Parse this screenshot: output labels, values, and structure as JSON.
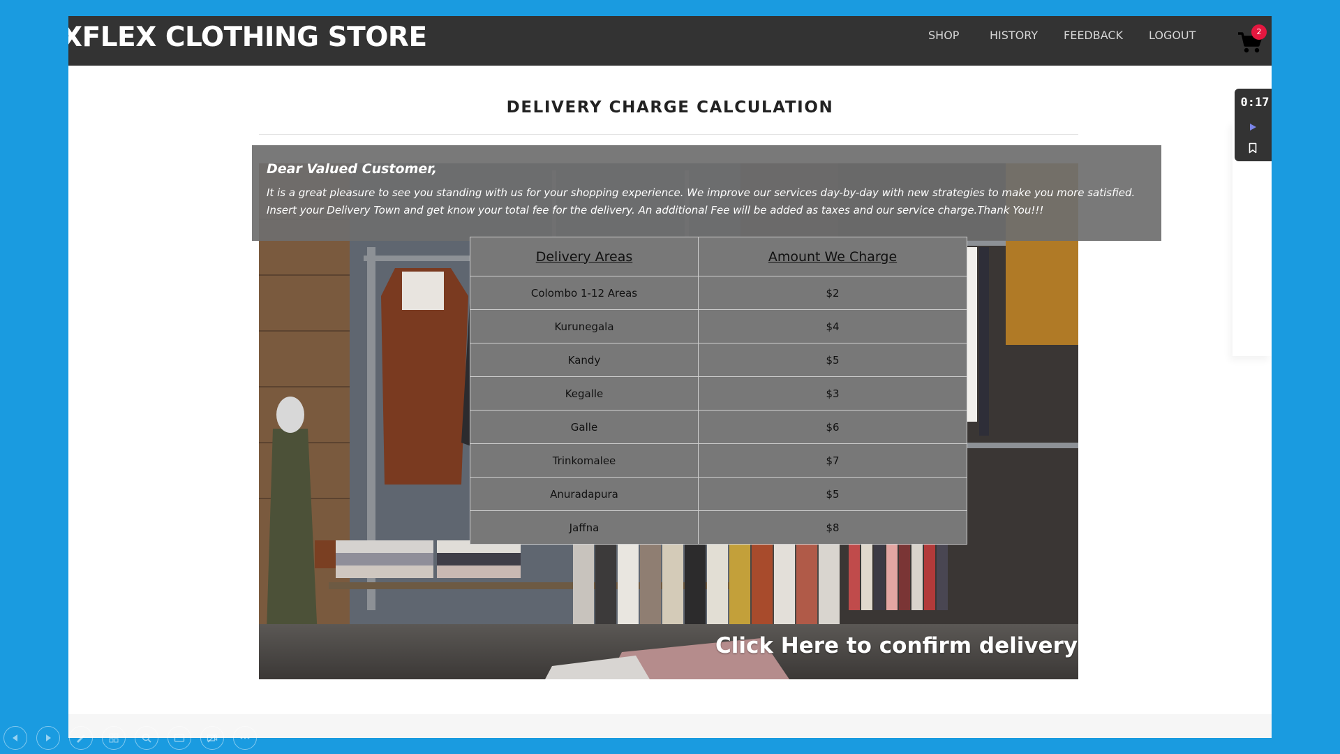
{
  "header": {
    "brand": "XFLEX CLOTHING STORE",
    "nav": [
      "SHOP",
      "HISTORY",
      "FEEDBACK",
      "LOGOUT"
    ],
    "cart_count": "2"
  },
  "timer": {
    "time": "0:17"
  },
  "page": {
    "title": "DELIVERY CHARGE CALCULATION"
  },
  "notice": {
    "greeting": "Dear Valued Customer,",
    "body": "It is a great pleasure to see you standing with us for your shopping experience. We improve our services day-by-day with new strategies to make you more satisfied. Insert your Delivery Town and get know your total fee for the delivery. An additional Fee will be added as taxes and our service charge.Thank You!!!"
  },
  "table": {
    "headers": [
      "Delivery Areas",
      "Amount We Charge"
    ],
    "rows": [
      [
        "Colombo 1-12 Areas",
        "$2"
      ],
      [
        "Kurunegala",
        "$4"
      ],
      [
        "Kandy",
        "$5"
      ],
      [
        "Kegalle",
        "$3"
      ],
      [
        "Galle",
        "$6"
      ],
      [
        "Trinkomalee",
        "$7"
      ],
      [
        "Anuradapura",
        "$5"
      ],
      [
        "Jaffna",
        "$8"
      ]
    ]
  },
  "confirm": {
    "label": "Click Here to confirm delivery"
  },
  "presenter_toolbar": [
    "previous-icon",
    "next-icon",
    "pen-icon",
    "slides-icon",
    "zoom-icon",
    "subtitles-icon",
    "camera-off-icon",
    "more-icon"
  ]
}
